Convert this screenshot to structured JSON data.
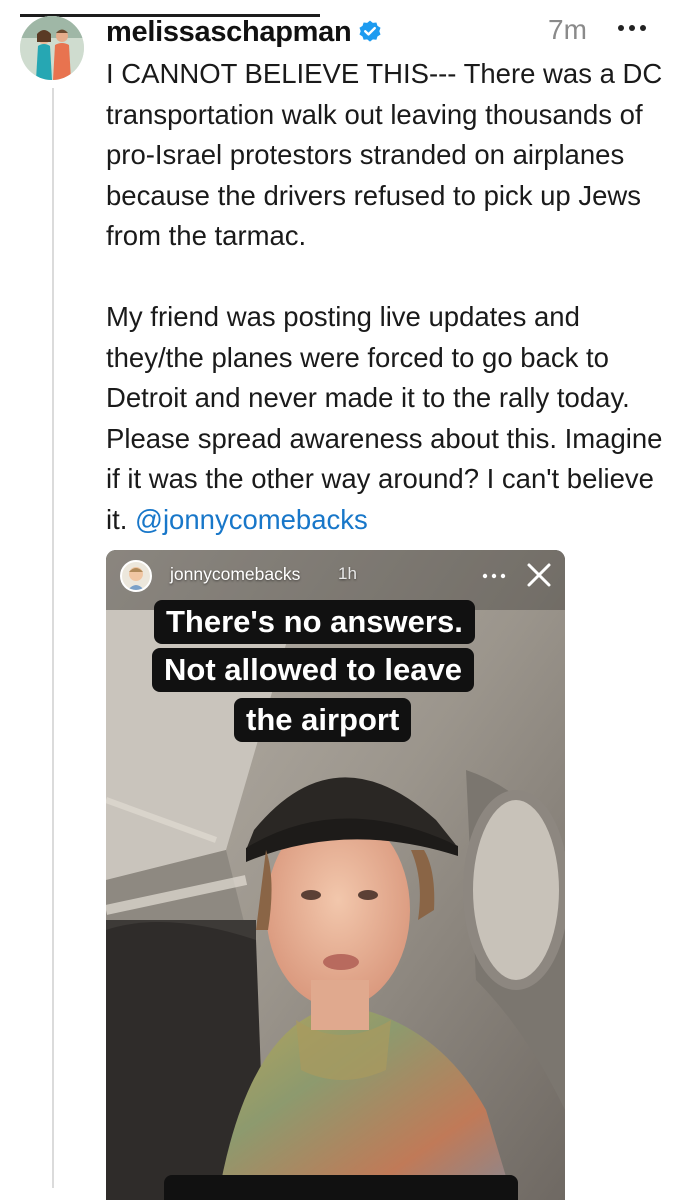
{
  "post": {
    "username": "melissaschapman",
    "verified_icon": "verified-badge-icon",
    "timestamp": "7m",
    "more_icon": "more-horizontal-icon",
    "paragraph_1": "I CANNOT BELIEVE THIS--- There was a DC transportation walk out leaving thousands of pro-Israel protestors stranded on airplanes because the drivers refused to pick up Jews from the tarmac.",
    "paragraph_2_text": "My friend was posting live updates and they/the planes were forced to go back to Detroit and never made it to the rally today. Please spread awareness about this. Imagine if it was the other way around? I can't believe it.",
    "mention": "@jonnycomebacks"
  },
  "story": {
    "username": "jonnycomebacks",
    "time": "1h",
    "more_icon": "more-horizontal-icon",
    "close_icon": "close-icon",
    "caption_lines": [
      "There's no answers.",
      "Not allowed to leave",
      "the airport"
    ]
  },
  "colors": {
    "mention": "#1877c9",
    "verified": "#1d9bf0",
    "thread_line": "#dbdbdb",
    "timestamp": "#8a8a8a"
  }
}
